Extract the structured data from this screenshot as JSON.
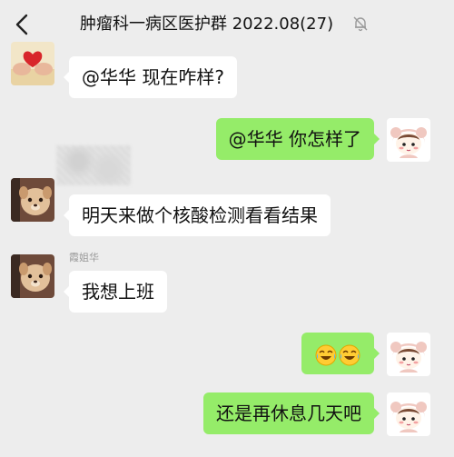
{
  "header": {
    "title": "肿瘤科一病区医护群 2022.08(27)",
    "back_icon": "chevron-left-icon",
    "mute_icon": "muted-bell-icon"
  },
  "messages": [
    {
      "side": "left",
      "text": "@华华 现在咋样?",
      "avatar": "red-hands-heart-avatar"
    },
    {
      "side": "right",
      "text": "@华华 你怎样了",
      "avatar": "cartoon-girl-avatar"
    },
    {
      "side": "left",
      "text": "明天来做个核酸检测看看结果",
      "avatar": "dog-avatar"
    },
    {
      "side": "left",
      "sender": "霞姐华",
      "text": "我想上班",
      "avatar": "dog-avatar"
    },
    {
      "side": "right",
      "emoji": [
        "crying-laughing-emoji",
        "crying-laughing-emoji"
      ],
      "avatar": "cartoon-girl-avatar"
    },
    {
      "side": "right",
      "text": "还是再休息几天吧",
      "avatar": "cartoon-girl-avatar"
    }
  ],
  "colors": {
    "background": "#ededed",
    "bubble_incoming": "#ffffff",
    "bubble_outgoing": "#95ec69",
    "name_label": "#9a9a9a"
  }
}
